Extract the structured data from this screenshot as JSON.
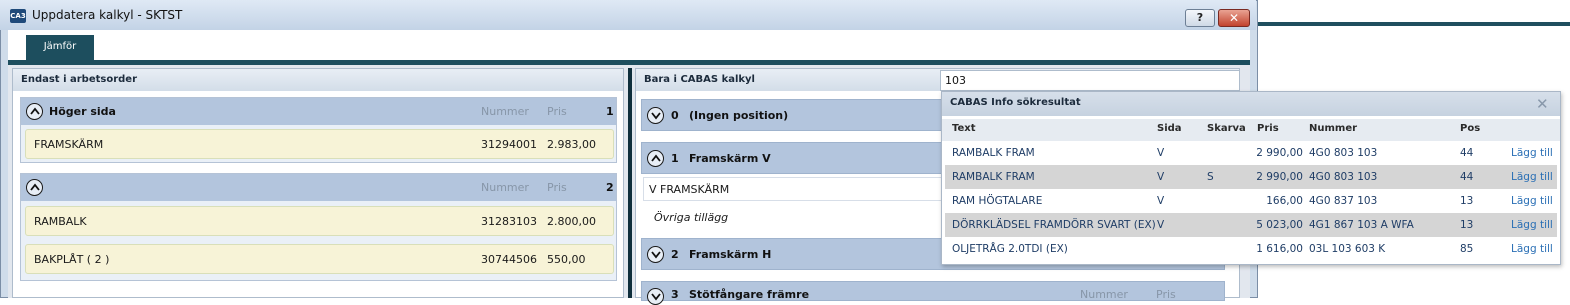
{
  "window": {
    "title": "Uppdatera kalkyl - SKTST",
    "app_icon_text": "CA3",
    "help_label": "?",
    "close_label": "✕"
  },
  "tabs": [
    {
      "label": "Jämför",
      "active": true
    }
  ],
  "left_panel": {
    "title": "Endast i arbetsorder",
    "groups": [
      {
        "title": "Höger sida",
        "col_number": "Nummer",
        "col_price": "Pris",
        "count": "1",
        "items": [
          {
            "text": "FRAMSKÄRM",
            "number": "31294001",
            "price": "2.983,00"
          }
        ]
      },
      {
        "title": "",
        "col_number": "Nummer",
        "col_price": "Pris",
        "count": "2",
        "items": [
          {
            "text": "RAMBALK",
            "number": "31283103",
            "price": "2.800,00"
          },
          {
            "text": "BAKPLÅT  ( 2 )",
            "number": "30744506",
            "price": "550,00"
          }
        ]
      }
    ]
  },
  "right_panel": {
    "title": "Bara i CABAS kalkyl",
    "search_value": "103",
    "groups": [
      {
        "num": "0",
        "title": "(Ingen position)"
      },
      {
        "num": "1",
        "title": "Framskärm V",
        "rows": [
          {
            "text": "V FRAMSKÄRM"
          },
          {
            "text": "Övriga tillägg"
          }
        ]
      },
      {
        "num": "2",
        "title": "Framskärm H"
      },
      {
        "num": "3",
        "title": "Stötfångare främre",
        "col_number": "Nummer",
        "col_price": "Pris"
      }
    ]
  },
  "popup": {
    "title": "CABAS Info sökresultat",
    "close_icon": "x-icon",
    "columns": {
      "text": "Text",
      "side": "Sida",
      "cut": "Skarva",
      "price": "Pris",
      "number": "Nummer",
      "pos": "Pos"
    },
    "rows": [
      {
        "text": "RAMBALK FRAM",
        "side": "V",
        "cut": "",
        "price": "2 990,00",
        "number": "4G0 803 103",
        "pos": "44",
        "action": "Lägg till"
      },
      {
        "text": "RAMBALK FRAM",
        "side": "V",
        "cut": "S",
        "price": "2 990,00",
        "number": "4G0 803 103",
        "pos": "44",
        "action": "Lägg till"
      },
      {
        "text": "RAM HÖGTALARE",
        "side": "V",
        "cut": "",
        "price": "166,00",
        "number": "4G0 837 103",
        "pos": "13",
        "action": "Lägg till"
      },
      {
        "text": "DÖRRKLÄDSEL FRAMDÖRR SVART (EX)",
        "side": "V",
        "cut": "",
        "price": "5 023,00",
        "number": "4G1 867 103 A  WFA",
        "pos": "13",
        "action": "Lägg till"
      },
      {
        "text": "OLJETRÅG 2.0TDI (EX)",
        "side": "",
        "cut": "",
        "price": "1 616,00",
        "number": "03L 103 603 K",
        "pos": "85",
        "action": "Lägg till"
      }
    ]
  },
  "colors": {
    "tab_accent": "#1d4e5e",
    "group_header": "#b3c5dd",
    "item_bg": "#f7f3d7",
    "link": "#2a6fb5"
  }
}
